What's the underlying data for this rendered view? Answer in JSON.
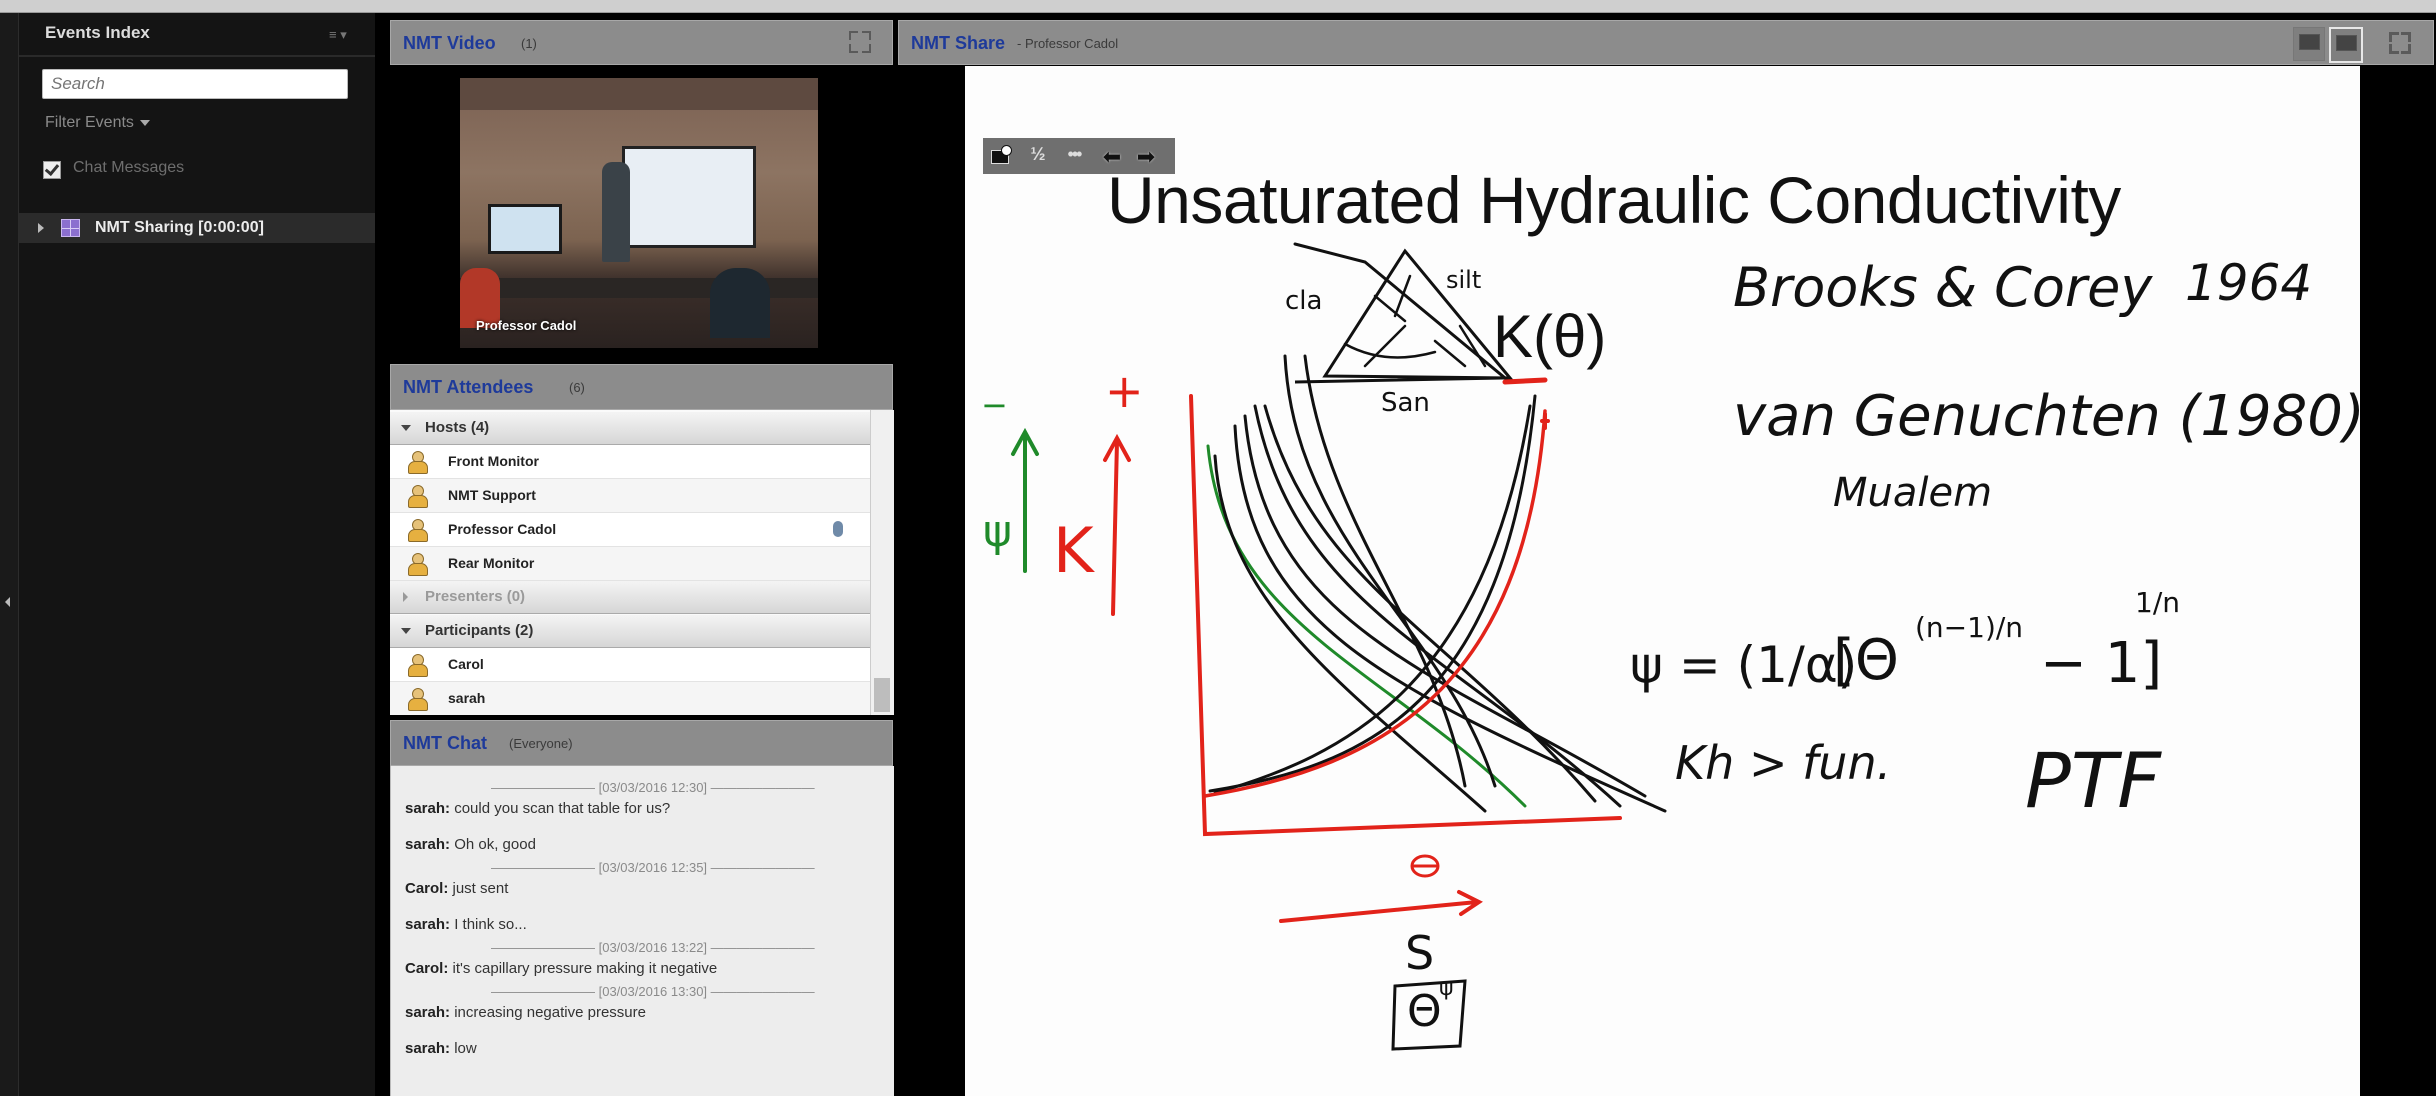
{
  "events_index": {
    "title": "Events Index",
    "menu_glyph": "≡ ▾",
    "search_placeholder": "Search",
    "filter_label": "Filter Events",
    "chat_messages_label": "Chat Messages",
    "chat_messages_checked": true,
    "items": [
      {
        "label": "NMT Sharing [0:00:00]"
      }
    ]
  },
  "video_pod": {
    "title": "NMT Video",
    "count": "(1)",
    "caption": "Professor Cadol"
  },
  "attendees_pod": {
    "title": "NMT Attendees",
    "count": "(6)",
    "groups": [
      {
        "label": "Hosts (4)",
        "expanded": true,
        "members": [
          "Front Monitor",
          "NMT Support",
          "Professor Cadol",
          "Rear Monitor"
        ]
      },
      {
        "label": "Presenters (0)",
        "expanded": false,
        "members": []
      },
      {
        "label": "Participants (2)",
        "expanded": true,
        "members": [
          "Carol",
          "sarah"
        ]
      }
    ]
  },
  "chat_pod": {
    "title": "NMT Chat",
    "audience": "(Everyone)",
    "entries": [
      {
        "type": "sep",
        "text": "———————— [03/03/2016 12:30] ————————"
      },
      {
        "type": "msg",
        "sender": "sarah:",
        "text": " could you scan that table for us?"
      },
      {
        "type": "msg",
        "sender": "sarah:",
        "text": " Oh ok, good"
      },
      {
        "type": "sep",
        "text": "———————— [03/03/2016 12:35] ————————"
      },
      {
        "type": "msg",
        "sender": "Carol:",
        "text": " just sent"
      },
      {
        "type": "msg",
        "sender": "sarah:",
        "text": " I think so..."
      },
      {
        "type": "sep",
        "text": "———————— [03/03/2016 13:22] ————————"
      },
      {
        "type": "msg",
        "sender": "Carol:",
        "text": " it's capillary pressure making it negative"
      },
      {
        "type": "sep",
        "text": "———————— [03/03/2016 13:30] ————————"
      },
      {
        "type": "msg",
        "sender": "sarah:",
        "text": " increasing negative pressure"
      },
      {
        "type": "msg",
        "sender": "sarah:",
        "text": " low"
      }
    ]
  },
  "share_pod": {
    "title": "NMT Share",
    "presenter": "- Professor Cadol",
    "toolbar_icons": [
      "webcam-icon",
      "scale-icon",
      "more-icon",
      "back-arrow-icon",
      "forward-arrow-icon"
    ]
  },
  "whiteboard": {
    "title": "Unsaturated Hydraulic Conductivity",
    "notes": {
      "brooks_corey": "Brooks & Corey",
      "brooks_corey_year": "1964",
      "van_genuchten": "van Genuchten (1980)",
      "mualem": "Mualem",
      "k_theta": "K(θ)",
      "clay": "cla",
      "silt": "silt",
      "sand": "San",
      "psi_label": "ψ",
      "k_label": "K",
      "minus": "−",
      "plus": "+",
      "theta_axis": "θ",
      "s_label": "S",
      "boxed": "Θ",
      "boxed_sup": "ψ",
      "equation_lhs": "ψ = (1/α)",
      "equation_bracket": "[Θ",
      "equation_exp": "(n−1)/n",
      "equation_tail": "− 1]",
      "equation_power": "1/n",
      "kh": "Kh > fun.",
      "ptf": "PTF"
    }
  },
  "colors": {
    "pod_title": "#1e3a9a",
    "ink_red": "#e2231a",
    "ink_green": "#1f8a2a",
    "ink_black": "#111111"
  }
}
